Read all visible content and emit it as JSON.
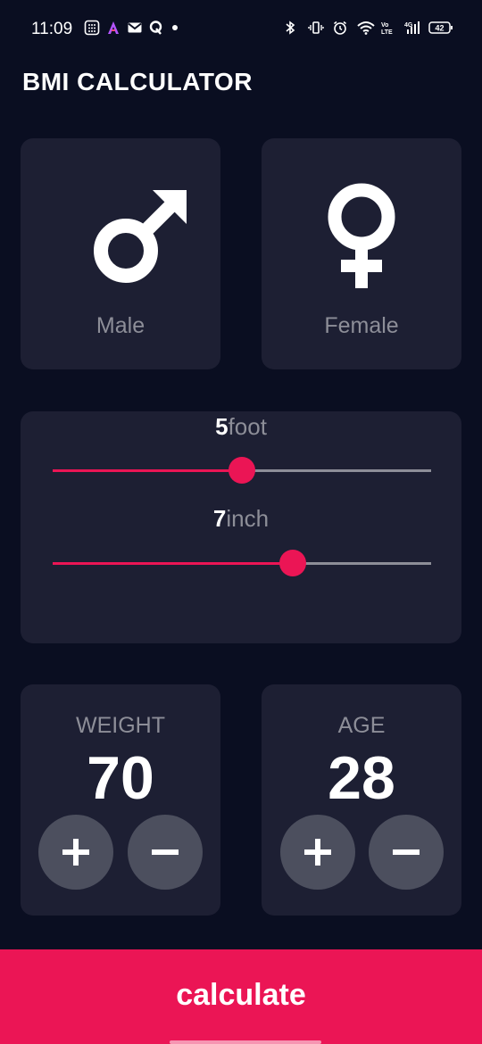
{
  "status_bar": {
    "time": "11:09",
    "battery": "42"
  },
  "app": {
    "title": "BMI CALCULATOR"
  },
  "gender": {
    "male_label": "Male",
    "female_label": "Female"
  },
  "height": {
    "feet_value": "5",
    "feet_unit": "foot",
    "inch_value": "7",
    "inch_unit": "inch",
    "feet_slider_fraction": 0.5,
    "inch_slider_fraction": 0.635
  },
  "weight": {
    "label": "WEIGHT",
    "value": "70"
  },
  "age": {
    "label": "AGE",
    "value": "28"
  },
  "calculate": {
    "label": "calculate"
  },
  "colors": {
    "background": "#0a0e21",
    "card": "#1d1f33",
    "accent": "#eb1555",
    "button": "#4c4f5e",
    "muted_text": "#8d8e98"
  }
}
